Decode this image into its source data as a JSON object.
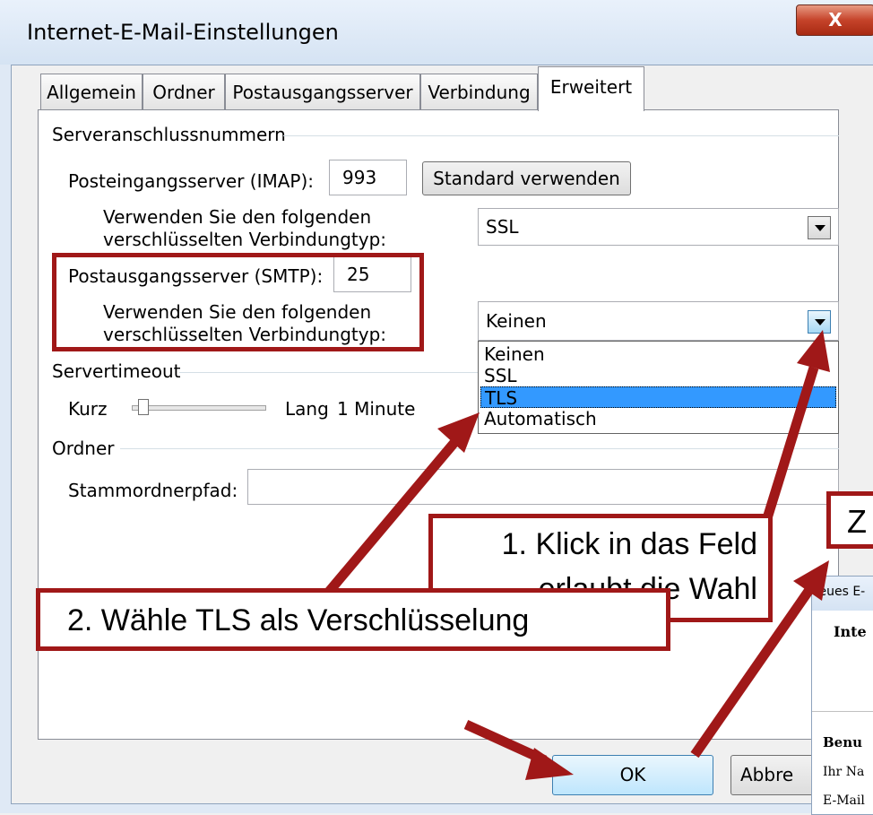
{
  "window": {
    "title": "Internet-E-Mail-Einstellungen",
    "close_label": "X"
  },
  "tabs": [
    "Allgemein",
    "Ordner",
    "Postausgangsserver",
    "Verbindung",
    "Erweitert"
  ],
  "active_tab": "Erweitert",
  "groups": {
    "server_ports": "Serveranschlussnummern",
    "timeout": "Servertimeout",
    "folder": "Ordner"
  },
  "imap": {
    "label": "Posteingangsserver (IMAP):",
    "port": "993",
    "default_button": "Standard verwenden",
    "enc_label_line1": "Verwenden Sie den folgenden",
    "enc_label_line2": "verschlüsselten Verbindungtyp:",
    "enc_value": "SSL"
  },
  "smtp": {
    "label": "Postausgangsserver (SMTP):",
    "port": "25",
    "enc_label_line1": "Verwenden Sie den folgenden",
    "enc_label_line2": "verschlüsselten Verbindungtyp:",
    "enc_value": "Keinen",
    "options": [
      "Keinen",
      "SSL",
      "TLS",
      "Automatisch"
    ],
    "highlighted_option": "TLS"
  },
  "timeout": {
    "short": "Kurz",
    "long": "Lang",
    "value": "1 Minute",
    "level": 0.05
  },
  "folder": {
    "root_label": "Stammordnerpfad:",
    "root_value": ""
  },
  "buttons": {
    "ok": "OK",
    "cancel": "Abbre"
  },
  "callouts": {
    "step1_line1": "1. Klick in das Feld",
    "step1_line2": "erlaubt die Wahl",
    "step2": "2. Wähle TLS als Verschlüsselung",
    "step3_partial": "Z"
  },
  "background_window": {
    "title": "Neues E-",
    "heading": "Inte",
    "section": "Benu",
    "name_label": "Ihr Na",
    "mail_label": "E-Mail"
  },
  "colors": {
    "annotation": "#a01818",
    "selection": "#3399ff"
  }
}
